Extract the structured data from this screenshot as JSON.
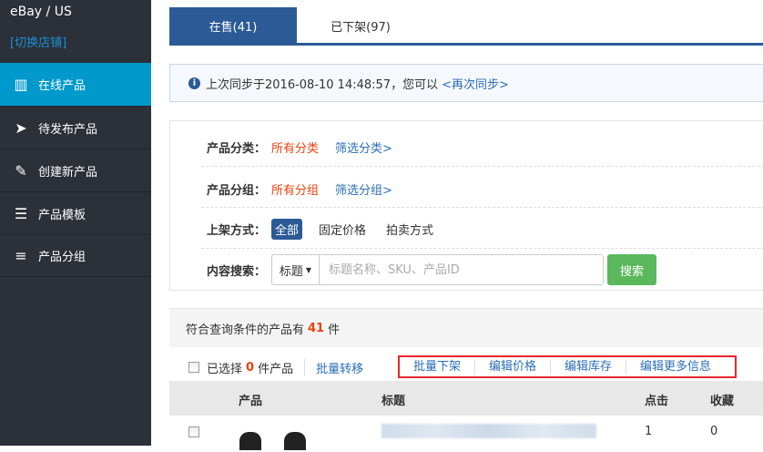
{
  "sidebar": {
    "store": "eBay / US",
    "switch_store": "[切换店铺]",
    "items": [
      {
        "label": "在线产品",
        "icon": "barcode-icon"
      },
      {
        "label": "待发布产品",
        "icon": "paper-plane-icon"
      },
      {
        "label": "创建新产品",
        "icon": "pencil-icon"
      },
      {
        "label": "产品模板",
        "icon": "list-icon"
      },
      {
        "label": "产品分组",
        "icon": "bars-icon"
      }
    ]
  },
  "tabs": [
    {
      "label": "在售(41)"
    },
    {
      "label": "已下架(97)"
    }
  ],
  "info": {
    "text": "上次同步于2016-08-10 14:48:57，您可以",
    "link": "<再次同步>"
  },
  "filters": {
    "category": {
      "label": "产品分类：",
      "value": "所有分类",
      "link": "筛选分类>"
    },
    "group": {
      "label": "产品分组：",
      "value": "所有分组",
      "link": "筛选分组>"
    },
    "listing": {
      "label": "上架方式：",
      "options": [
        "全部",
        "固定价格",
        "拍卖方式"
      ]
    },
    "search": {
      "label": "内容搜索：",
      "field": "标题",
      "placeholder": "标题名称、SKU、产品ID",
      "button": "搜索"
    }
  },
  "count": {
    "prefix": "符合查询条件的产品有",
    "value": "41",
    "suffix": "件"
  },
  "toolbar": {
    "selected_prefix": "已选择",
    "selected_count": "0",
    "selected_suffix": "件产品",
    "batch_transfer": "批量转移",
    "actions": [
      "批量下架",
      "编辑价格",
      "编辑库存",
      "编辑更多信息"
    ]
  },
  "colors": {
    "accent": "#2c5a96",
    "sidebar_active": "#0099cc",
    "highlight": "#e8420f",
    "search_button": "#5cb85c"
  },
  "table": {
    "headers": [
      "产品",
      "标题",
      "点击",
      "收藏"
    ],
    "rows": [
      {
        "clicks": "1",
        "favorites": "0"
      }
    ]
  }
}
